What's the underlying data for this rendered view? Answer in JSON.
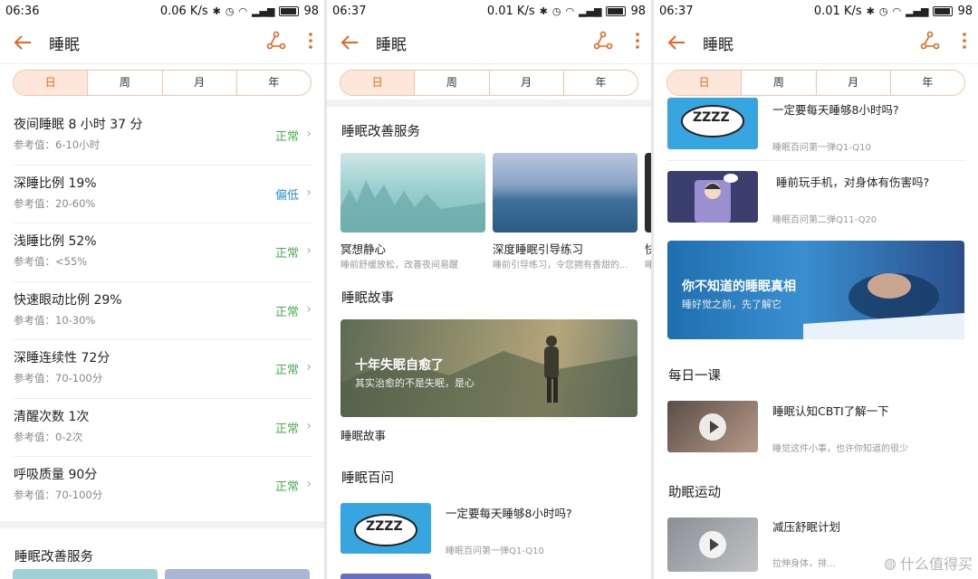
{
  "app": {
    "title": "睡眠",
    "accent": "#e8661f"
  },
  "tabs": [
    "日",
    "周",
    "月",
    "年"
  ],
  "panel1": {
    "status": {
      "time": "06:36",
      "speed": "0.06 K/s",
      "battery": "98"
    },
    "metrics": [
      {
        "name": "夜间睡眠  8 小时 37 分",
        "ref": "参考值：6-10小时",
        "status": "正常",
        "level": "normal"
      },
      {
        "name": "深睡比例  19%",
        "ref": "参考值：20-60%",
        "status": "偏低",
        "level": "low"
      },
      {
        "name": "浅睡比例  52%",
        "ref": "参考值：<55%",
        "status": "正常",
        "level": "normal"
      },
      {
        "name": "快速眼动比例  29%",
        "ref": "参考值：10-30%",
        "status": "正常",
        "level": "normal"
      },
      {
        "name": "深睡连续性  72分",
        "ref": "参考值：70-100分",
        "status": "正常",
        "level": "normal"
      },
      {
        "name": "清醒次数  1次",
        "ref": "参考值：0-2次",
        "status": "正常",
        "level": "normal"
      },
      {
        "name": "呼吸质量  90分",
        "ref": "参考值：70-100分",
        "status": "正常",
        "level": "normal"
      }
    ],
    "section": "睡眠改善服务"
  },
  "panel2": {
    "status": {
      "time": "06:37",
      "speed": "0.01 K/s",
      "battery": "98"
    },
    "service_title": "睡眠改善服务",
    "services": [
      {
        "title": "冥想静心",
        "sub": "睡前舒缓放松，改善夜间易醒"
      },
      {
        "title": "深度睡眠引导练习",
        "sub": "睡前引导练习，令您拥有香甜的..."
      },
      {
        "title": "快",
        "sub": "睡"
      }
    ],
    "story_title": "睡眠故事",
    "story_banner": {
      "title": "十年失眠自愈了",
      "sub": "其实治愈的不是失眠，是心"
    },
    "story_caption": "睡眠故事",
    "qa_title": "睡眠百问",
    "qa_items": [
      {
        "title": "一定要每天睡够8小时吗?",
        "sub": "睡眠百问第一弹Q1-Q10",
        "thumb_text": "ZZZZ"
      }
    ]
  },
  "panel3": {
    "status": {
      "time": "06:37",
      "speed": "0.01 K/s",
      "battery": "98"
    },
    "qa_items": [
      {
        "title": "一定要每天睡够8小时吗?",
        "sub": "睡眠百问第一弹Q1-Q10",
        "thumb_text": "ZZZZ"
      },
      {
        "title": "睡前玩手机，对身体有伤害吗?",
        "sub": "睡眠百问第二弹Q11-Q20"
      }
    ],
    "banner": {
      "title": "你不知道的睡眠真相",
      "sub": "睡好觉之前，先了解它"
    },
    "lesson_title": "每日一课",
    "lesson": {
      "title": "睡眠认知CBTI了解一下",
      "sub": "睡觉这件小事，也许你知道的很少"
    },
    "exercise_title": "助眠运动",
    "exercise": {
      "title": "减压舒眠计划",
      "sub": "拉伸身体，排..."
    },
    "watermark": "什么值得买"
  }
}
